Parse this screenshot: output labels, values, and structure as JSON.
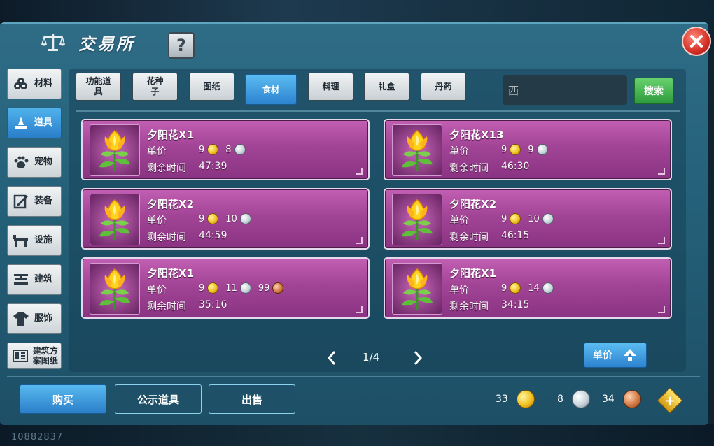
{
  "window": {
    "title": "交易所",
    "help": "?",
    "close": "×"
  },
  "sidebar": {
    "items": [
      {
        "label": "材料",
        "icon": "materials-icon",
        "active": false
      },
      {
        "label": "道具",
        "icon": "item-icon",
        "active": true
      },
      {
        "label": "宠物",
        "icon": "paw-icon",
        "active": false
      },
      {
        "label": "装备",
        "icon": "equipment-icon",
        "active": false
      },
      {
        "label": "设施",
        "icon": "facility-icon",
        "active": false
      },
      {
        "label": "建筑",
        "icon": "building-icon",
        "active": false
      },
      {
        "label": "服饰",
        "icon": "clothing-icon",
        "active": false
      },
      {
        "label": "建筑方案图纸",
        "icon": "blueprint-icon",
        "active": false
      }
    ]
  },
  "tabs": [
    {
      "label": "功能道具",
      "active": false
    },
    {
      "label": "花种子",
      "active": false
    },
    {
      "label": "图纸",
      "active": false
    },
    {
      "label": "食材",
      "active": true
    },
    {
      "label": "料理",
      "active": false
    },
    {
      "label": "礼盒",
      "active": false
    },
    {
      "label": "丹药",
      "active": false
    }
  ],
  "search": {
    "value": "西",
    "button": "搜索"
  },
  "labels": {
    "unit_price": "单价",
    "remaining_time": "剩余时间"
  },
  "listings": [
    {
      "name": "夕阳花X1",
      "gold": "9",
      "silver": "8",
      "copper": null,
      "time": "47:39"
    },
    {
      "name": "夕阳花X13",
      "gold": "9",
      "silver": "9",
      "copper": null,
      "time": "46:30"
    },
    {
      "name": "夕阳花X2",
      "gold": "9",
      "silver": "10",
      "copper": null,
      "time": "44:59"
    },
    {
      "name": "夕阳花X2",
      "gold": "9",
      "silver": "10",
      "copper": null,
      "time": "46:15"
    },
    {
      "name": "夕阳花X1",
      "gold": "9",
      "silver": "11",
      "copper": "99",
      "time": "35:16"
    },
    {
      "name": "夕阳花X1",
      "gold": "9",
      "silver": "14",
      "copper": null,
      "time": "34:15"
    }
  ],
  "pager": {
    "page": "1/4"
  },
  "sort": {
    "label": "单价"
  },
  "bottom": {
    "buy": "购买",
    "public": "公示道具",
    "sell": "出售",
    "gold": "33",
    "silver": "8",
    "copper": "34",
    "plus": "+"
  },
  "footer_id": "10882837",
  "colors": {
    "card": "#a24496",
    "active_tab": "#2d83cf",
    "search_button": "#2e9a3d",
    "close": "#d52f26"
  }
}
